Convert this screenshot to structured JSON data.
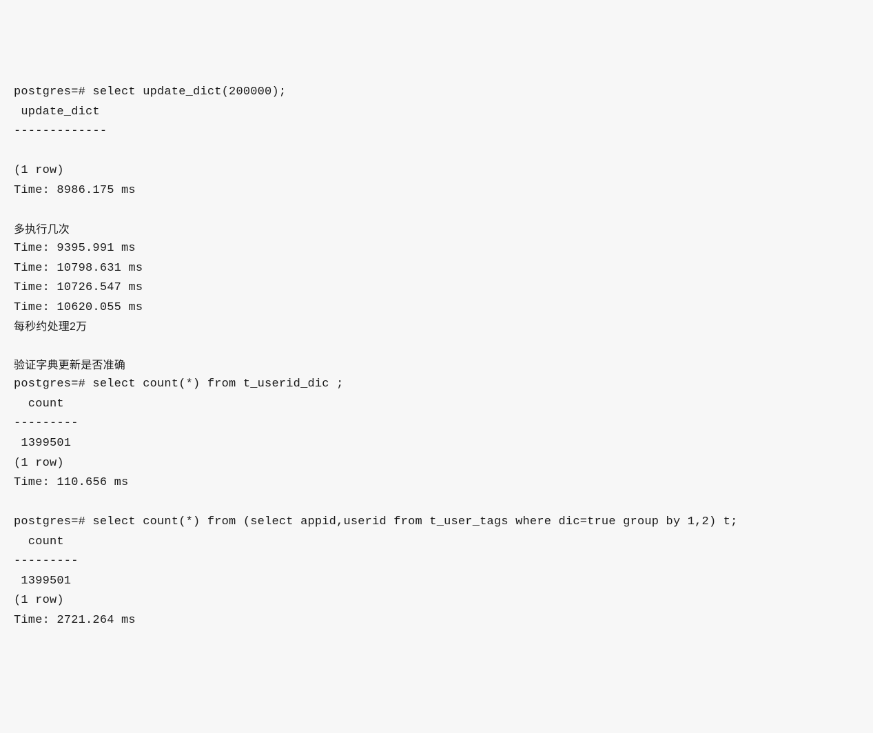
{
  "lines": [
    {
      "type": "code",
      "text": "postgres=# select update_dict(200000);"
    },
    {
      "type": "code",
      "text": " update_dict "
    },
    {
      "type": "code",
      "text": "-------------"
    },
    {
      "type": "code",
      "text": " "
    },
    {
      "type": "code",
      "text": "(1 row)"
    },
    {
      "type": "code",
      "text": "Time: 8986.175 ms"
    },
    {
      "type": "code",
      "text": ""
    },
    {
      "type": "comment",
      "text": "多执行几次"
    },
    {
      "type": "code",
      "text": "Time: 9395.991 ms"
    },
    {
      "type": "code",
      "text": "Time: 10798.631 ms"
    },
    {
      "type": "code",
      "text": "Time: 10726.547 ms"
    },
    {
      "type": "code",
      "text": "Time: 10620.055 ms"
    },
    {
      "type": "comment",
      "text": "每秒约处理2万"
    },
    {
      "type": "code",
      "text": ""
    },
    {
      "type": "comment",
      "text": "验证字典更新是否准确"
    },
    {
      "type": "code",
      "text": "postgres=# select count(*) from t_userid_dic ;"
    },
    {
      "type": "code",
      "text": "  count  "
    },
    {
      "type": "code",
      "text": "---------"
    },
    {
      "type": "code",
      "text": " 1399501"
    },
    {
      "type": "code",
      "text": "(1 row)"
    },
    {
      "type": "code",
      "text": "Time: 110.656 ms"
    },
    {
      "type": "code",
      "text": ""
    },
    {
      "type": "code",
      "text": "postgres=# select count(*) from (select appid,userid from t_user_tags where dic=true group by 1,2) t;"
    },
    {
      "type": "code",
      "text": "  count  "
    },
    {
      "type": "code",
      "text": "---------"
    },
    {
      "type": "code",
      "text": " 1399501"
    },
    {
      "type": "code",
      "text": "(1 row)"
    },
    {
      "type": "code",
      "text": "Time: 2721.264 ms"
    }
  ]
}
